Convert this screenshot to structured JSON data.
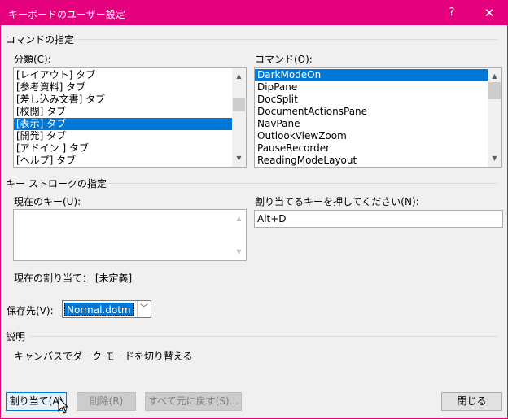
{
  "window": {
    "title": "キーボードのユーザー設定",
    "help": "?",
    "close": "✕"
  },
  "commands_group": {
    "title": "コマンドの指定",
    "category_label": "分類(C):",
    "category_items": [
      "[レイアウト] タブ",
      "[参考資料] タブ",
      "[差し込み文書] タブ",
      "[校閲] タブ",
      "[表示] タブ",
      "[開発] タブ",
      "[アドイン ] タブ",
      "[ヘルプ] タブ"
    ],
    "category_selected_index": 4,
    "command_label": "コマンド(O):",
    "command_items": [
      "DarkModeOn",
      "DipPane",
      "DocSplit",
      "DocumentActionsPane",
      "NavPane",
      "OutlookViewZoom",
      "PauseRecorder",
      "ReadingModeLayout"
    ],
    "command_selected_index": 0
  },
  "keystroke_group": {
    "title": "キー ストロークの指定",
    "current_keys_label": "現在のキー(U):",
    "new_key_label": "割り当てるキーを押してください(N):",
    "new_key_value": "Alt+D",
    "current_assignment": "現在の割り当て： [未定義]",
    "save_in_label": "保存先(V):",
    "save_in_value": "Normal.dotm"
  },
  "description_group": {
    "title": "説明",
    "text": "キャンバスでダーク モードを切り替える"
  },
  "buttons": {
    "assign": "割り当て(A)",
    "remove": "削除(R)",
    "reset_all": "すべて元に戻す(S)...",
    "close": "閉じる"
  },
  "colors": {
    "titlebar": "#e5007e",
    "selection": "#0078d7"
  }
}
